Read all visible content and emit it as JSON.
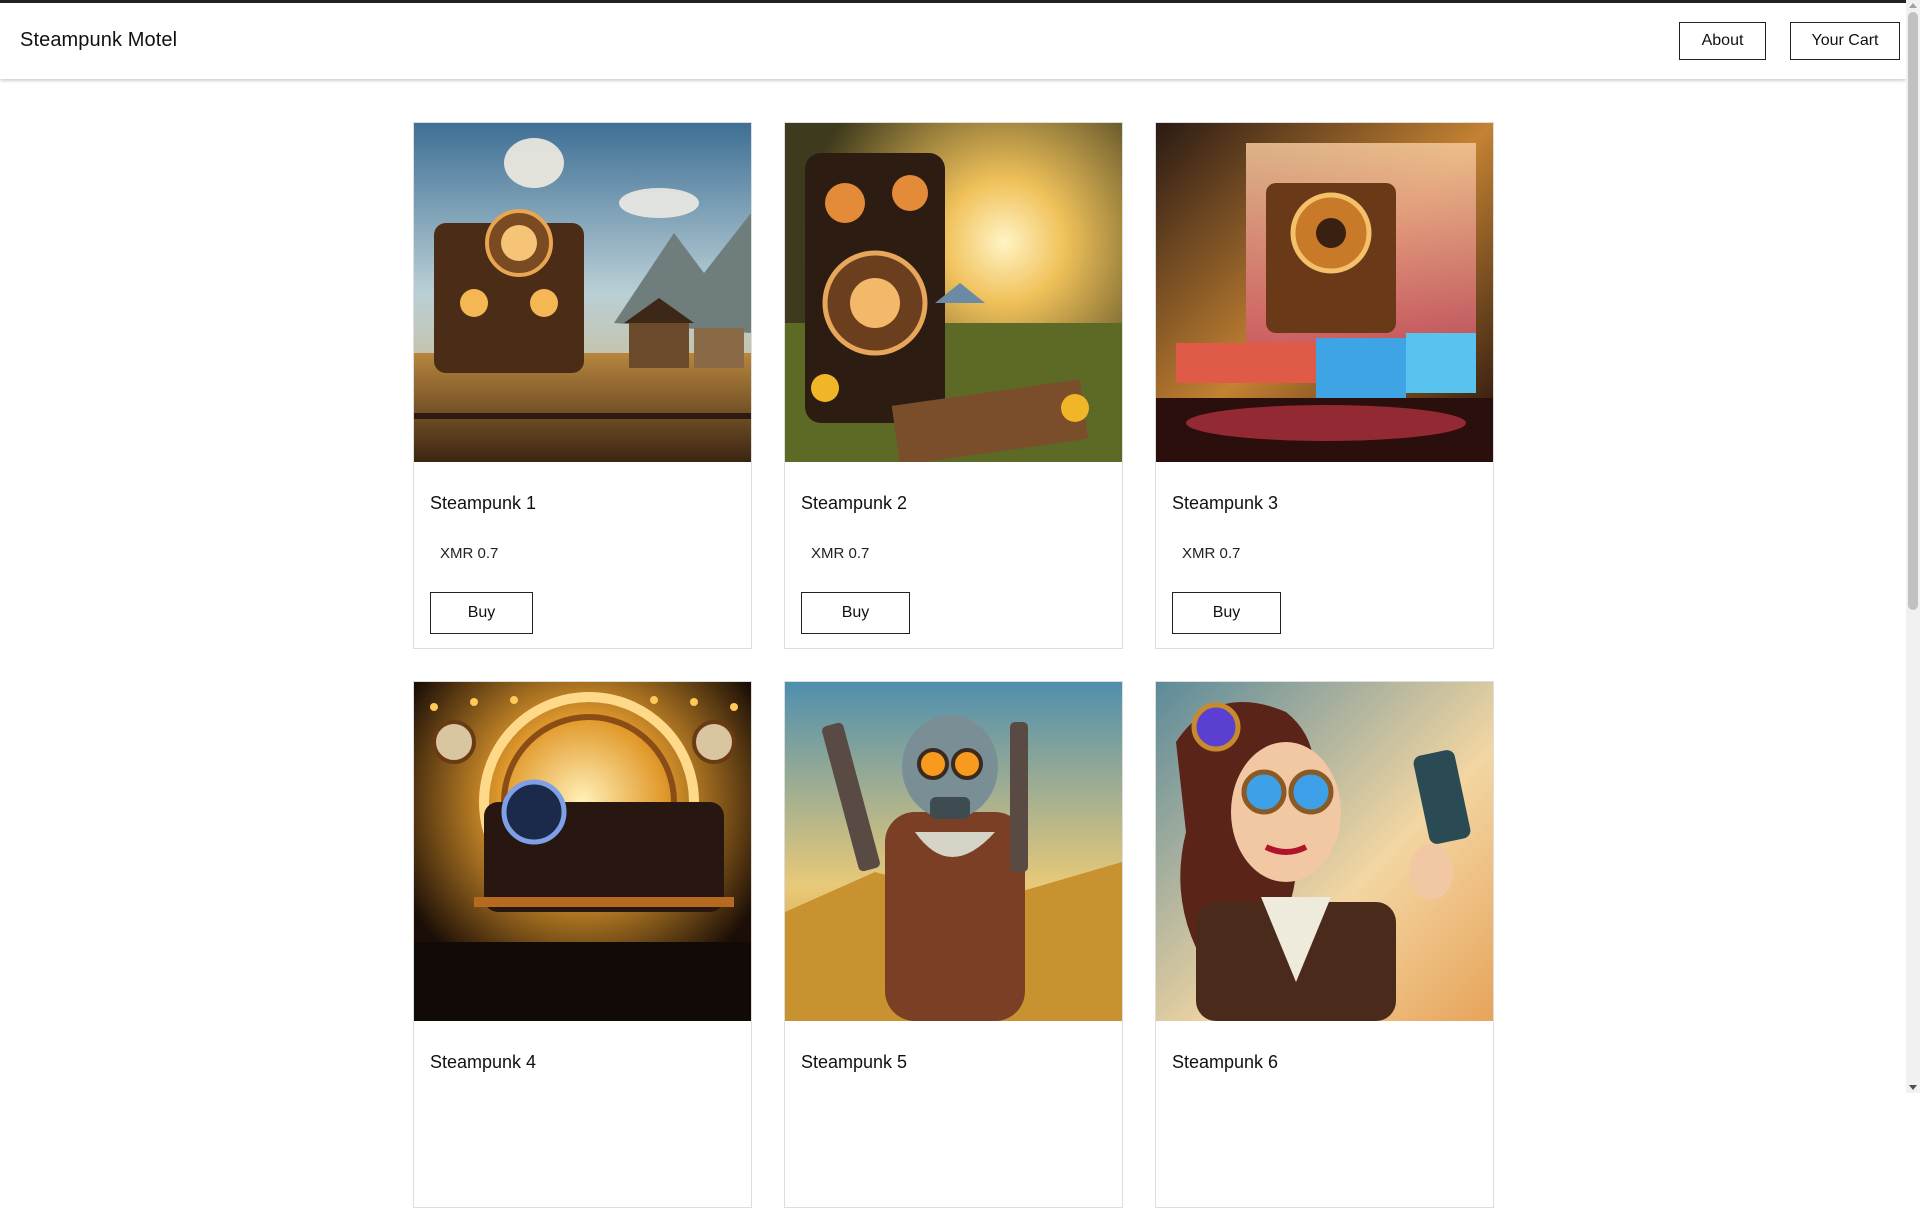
{
  "header": {
    "brand": "Steampunk Motel",
    "about_label": "About",
    "cart_label": "Your Cart"
  },
  "products": [
    {
      "title": "Steampunk 1",
      "price": "XMR 0.7",
      "buy_label": "Buy",
      "image": "steampunk-train-house-scene"
    },
    {
      "title": "Steampunk 2",
      "price": "XMR 0.7",
      "buy_label": "Buy",
      "image": "steampunk-picnic-machine-scene"
    },
    {
      "title": "Steampunk 3",
      "price": "XMR 0.7",
      "buy_label": "Buy",
      "image": "steampunk-waterfall-machine-scene"
    },
    {
      "title": "Steampunk 4",
      "image": "steampunk-clock-locomotive-scene"
    },
    {
      "title": "Steampunk 5",
      "image": "steampunk-gasmask-gunslinger-scene"
    },
    {
      "title": "Steampunk 6",
      "image": "steampunk-goggles-selfie-scene"
    }
  ],
  "colors": {
    "border": "#dddddd",
    "button_border": "#222222",
    "text": "#111111"
  }
}
